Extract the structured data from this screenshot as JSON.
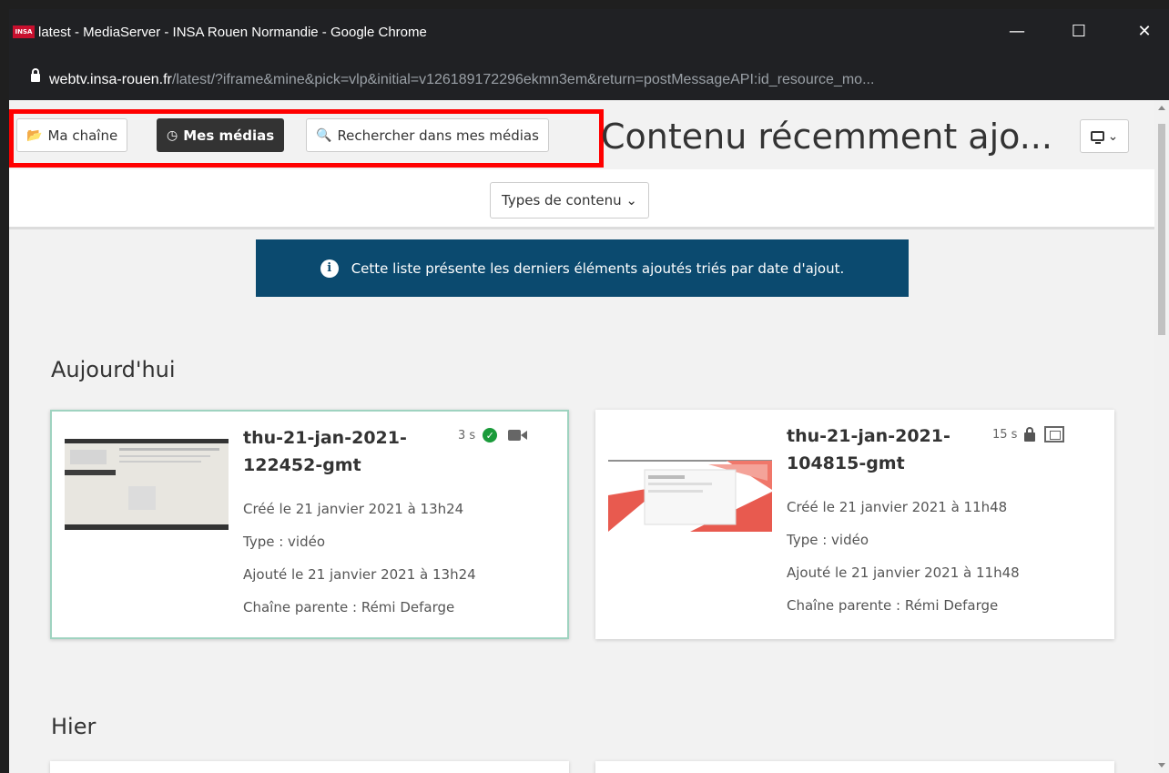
{
  "window": {
    "favicon_text": "INSA",
    "title": "latest - MediaServer - INSA Rouen Normandie - Google Chrome",
    "minimize": "—",
    "maximize": "☐",
    "close": "✕"
  },
  "address": {
    "host": "webtv.insa-rouen.fr",
    "path": "/latest/?iframe&mine&pick=vlp&initial=v126189172296ekmn3em&return=postMessageAPI:id_resource_mo..."
  },
  "toolbar": {
    "my_channel": "Ma chaîne",
    "my_media": "Mes médias",
    "search_my_media": "Rechercher dans mes médias",
    "page_title": "Contenu récemment ajo...",
    "display_chevron": "⌄"
  },
  "filters": {
    "content_types": "Types de contenu ⌄"
  },
  "info": {
    "icon_letter": "i",
    "message": "Cette liste présente les derniers éléments ajoutés triés par date d'ajout."
  },
  "colors": {
    "highlight": "#ff0000",
    "info_bg": "#0b4a6f",
    "published_green": "#1a9b3a",
    "selected_border": "#9fd3c0"
  },
  "sections": {
    "today": "Aujourd'hui",
    "yesterday": "Hier"
  },
  "cards": [
    {
      "title": "thu-21-jan-2021-122452-gmt",
      "duration": "3 s",
      "status_icon": "check-circle-icon",
      "type_icon": "video-camera-icon",
      "created": "Créé le 21 janvier 2021 à 13h24",
      "type": "Type : vidéo",
      "added": "Ajouté le 21 janvier 2021 à 13h24",
      "parent": "Chaîne parente : Rémi Defarge"
    },
    {
      "title": "thu-21-jan-2021-104815-gmt",
      "duration": "15 s",
      "status_icon": "lock-icon",
      "type_icon": "screen-recording-icon",
      "created": "Créé le 21 janvier 2021 à 11h48",
      "type": "Type : vidéo",
      "added": "Ajouté le 21 janvier 2021 à 11h48",
      "parent": "Chaîne parente : Rémi Defarge"
    }
  ]
}
